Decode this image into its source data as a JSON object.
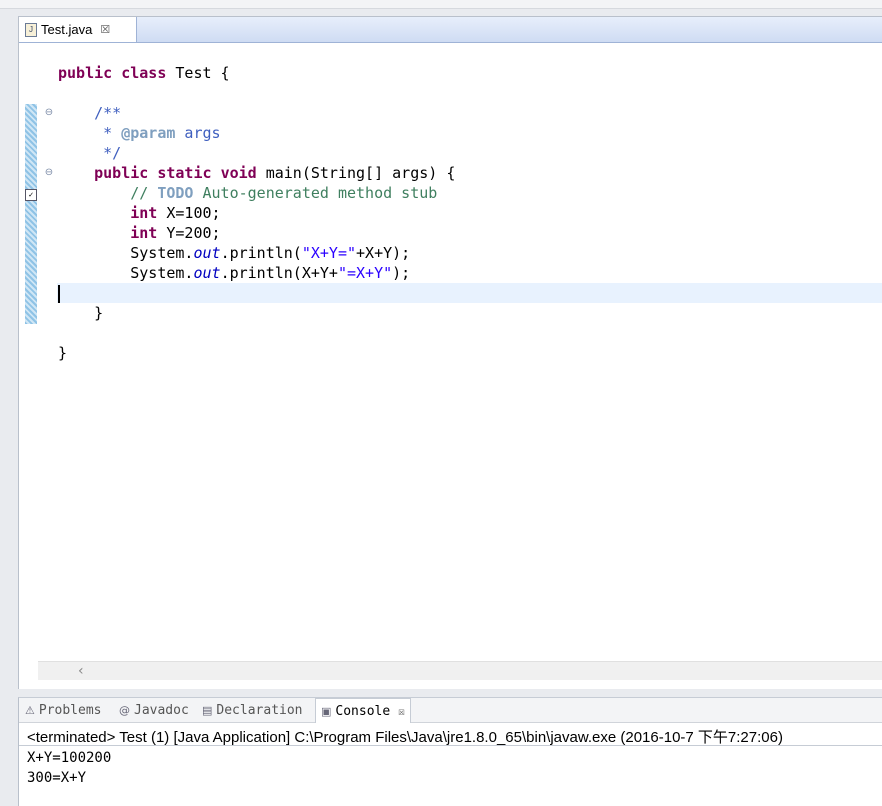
{
  "editor": {
    "tab": {
      "label": "Test.java",
      "icon": "java-file-icon",
      "close": "☒"
    },
    "code": {
      "l1": {
        "kw1": "public",
        "kw2": "class",
        "rest": " Test {"
      },
      "l3": {
        "indent": "    ",
        "text": "/**"
      },
      "l4": {
        "indent": "     * ",
        "tag": "@param",
        "rest": " args"
      },
      "l5": {
        "indent": "     ",
        "text": "*/"
      },
      "l6": {
        "indent": "    ",
        "kw1": "public",
        "kw2": "static",
        "kw3": "void",
        "rest": " main(String[] args) {"
      },
      "l7": {
        "indent": "        ",
        "pre": "// ",
        "todo": "TODO",
        "rest": " Auto-generated method stub"
      },
      "l8": {
        "indent": "        ",
        "kw": "int",
        "rest": " X=100;"
      },
      "l9": {
        "indent": "        ",
        "kw": "int",
        "rest": " Y=200;"
      },
      "l10": {
        "indent": "        ",
        "a": "System.",
        "fld": "out",
        "b": ".println(",
        "str": "\"X+Y=\"",
        "c": "+X+Y);"
      },
      "l11": {
        "indent": "        ",
        "a": "System.",
        "fld": "out",
        "b": ".println(X+Y+",
        "str": "\"=X+Y\"",
        "c": ");"
      },
      "l13": {
        "indent": "    ",
        "text": "}"
      },
      "l15": {
        "text": "}"
      }
    }
  },
  "panel": {
    "tabs": [
      {
        "label": "Problems",
        "icon": "problems-icon"
      },
      {
        "label": "Javadoc",
        "icon": "javadoc-icon"
      },
      {
        "label": "Declaration",
        "icon": "declaration-icon"
      },
      {
        "label": "Console",
        "icon": "console-icon",
        "close": "☒"
      }
    ],
    "console": {
      "header": "<terminated> Test (1) [Java Application] C:\\Program Files\\Java\\jre1.8.0_65\\bin\\javaw.exe (2016-10-7 下午7:27:06)",
      "output": [
        "X+Y=100200",
        "300=X+Y"
      ]
    }
  }
}
